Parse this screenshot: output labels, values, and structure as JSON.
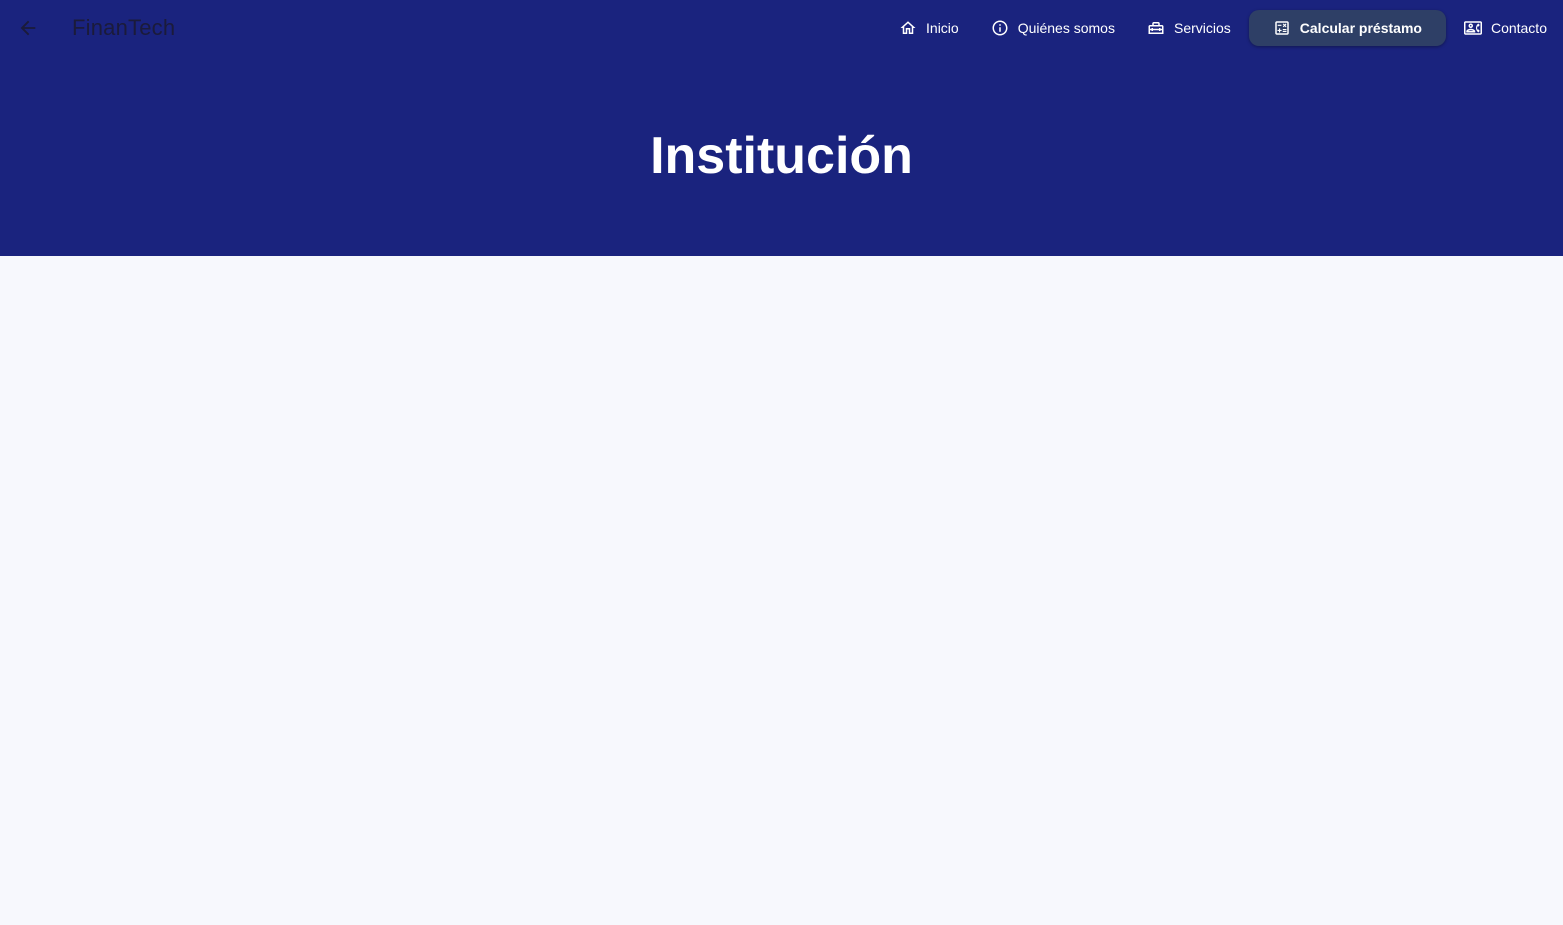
{
  "app": {
    "brand": "FinanTech"
  },
  "nav": {
    "items": [
      {
        "label": "Inicio",
        "icon": "home-icon"
      },
      {
        "label": "Quiénes somos",
        "icon": "info-icon"
      },
      {
        "label": "Servicios",
        "icon": "toolbox-icon"
      },
      {
        "label": "Calcular préstamo",
        "icon": "calculator-icon",
        "active": true
      },
      {
        "label": "Contacto",
        "icon": "contact-card-icon"
      }
    ]
  },
  "hero": {
    "title": "Institución"
  },
  "colors": {
    "header_bg": "#1a237e",
    "active_nav_bg": "#2e3f66",
    "page_bg": "#f7f8fd"
  }
}
